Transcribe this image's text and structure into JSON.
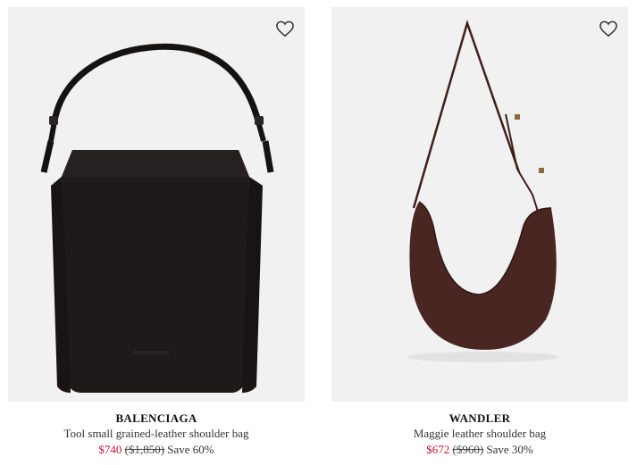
{
  "products": [
    {
      "designer": "BALENCIAGA",
      "name": "Tool small grained-leather shoulder bag",
      "price_now": "$740",
      "price_was": "($1,850)",
      "save": "Save 60%",
      "wishlist_icon": "heart-outline-icon",
      "image_bg": "#f1f1f1",
      "bag_color": "#1f1a19"
    },
    {
      "designer": "WANDLER",
      "name": "Maggie leather shoulder bag",
      "price_now": "$672",
      "price_was": "($960)",
      "save": "Save 30%",
      "wishlist_icon": "heart-outline-icon",
      "image_bg": "#f1f1f1",
      "bag_color": "#4a2622"
    }
  ],
  "colors": {
    "sale_price": "#c8102e"
  }
}
